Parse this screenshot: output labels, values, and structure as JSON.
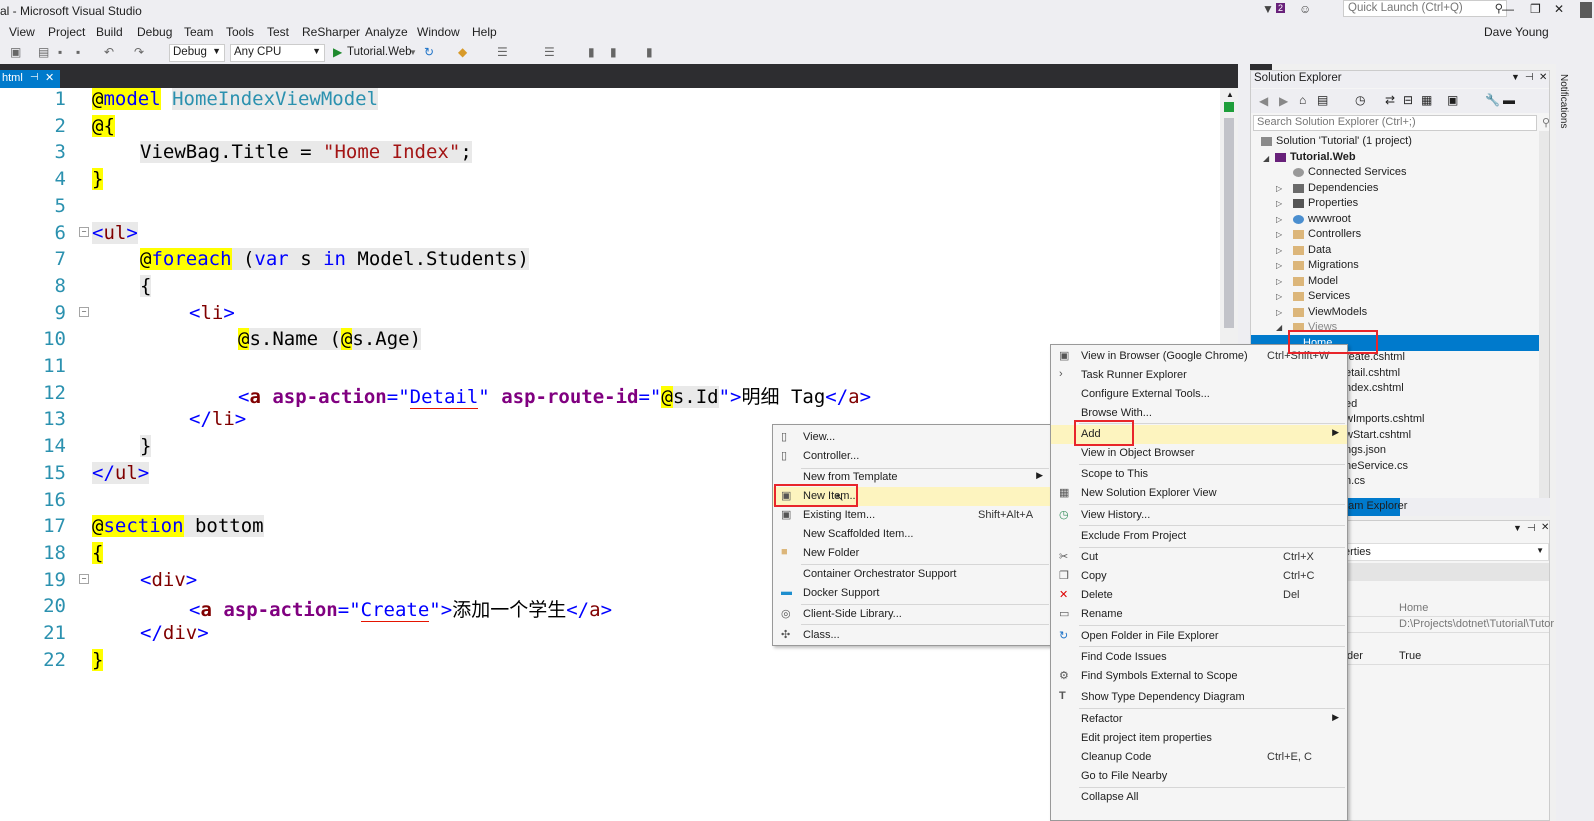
{
  "window": {
    "title": "al - Microsoft Visual Studio",
    "quick_launch_placeholder": "Quick Launch (Ctrl+Q)",
    "notification_count": "2",
    "user": "Dave Young"
  },
  "menubar": [
    "View",
    "Project",
    "Build",
    "Debug",
    "Team",
    "Tools",
    "Test",
    "ReSharper",
    "Analyze",
    "Window",
    "Help"
  ],
  "toolbar": {
    "config": "Debug",
    "platform": "Any CPU",
    "start_target": "Tutorial.Web"
  },
  "editor": {
    "tab_label": "html",
    "line_numbers": [
      "1",
      "2",
      "3",
      "4",
      "5",
      "6",
      "7",
      "8",
      "9",
      "10",
      "11",
      "12",
      "13",
      "14",
      "15",
      "16",
      "17",
      "18",
      "19",
      "20",
      "21",
      "22"
    ],
    "l1": {
      "at": "@",
      "kw": "model",
      "type": "HomeIndexViewModel"
    },
    "l2": "@{",
    "l3": {
      "a": "ViewBag.Title = ",
      "b": "\"Home Index\"",
      "c": ";"
    },
    "l4": "}",
    "l6": {
      "open": "<",
      "tag": "ul",
      "close": ">"
    },
    "l7": {
      "at": "@",
      "kw": "foreach",
      "a": " (",
      "var": "var",
      "b": " s ",
      "in": "in",
      "c": " Model.Students)"
    },
    "l8": "{",
    "l9": {
      "open": "<",
      "tag": "li",
      "close": ">"
    },
    "l10": {
      "at1": "@",
      "a": "s.Name (",
      "at2": "@",
      "b": "s.Age)"
    },
    "l12": {
      "open": "<",
      "tag": "a",
      "attr1": " asp-action",
      "eq1": "=",
      "q1": "\"",
      "v1": "Detail",
      "q2": "\"",
      "attr2": " asp-route-id",
      "eq2": "=",
      "q3": "\"",
      "at": "@",
      "v2": "s.Id",
      "q4": "\"",
      "gt": ">",
      "text": "明细 Tag",
      "end": "</",
      "etag": "a",
      "egt": ">"
    },
    "l13": {
      "open": "</",
      "tag": "li",
      "close": ">"
    },
    "l14": "}",
    "l15": {
      "open": "</",
      "tag": "ul",
      "close": ">"
    },
    "l17": {
      "at": "@",
      "kw": "section",
      "rest": " bottom"
    },
    "l18": "{",
    "l19": {
      "open": "<",
      "tag": "div",
      "close": ">"
    },
    "l20": {
      "open": "<",
      "tag": "a",
      "attr": " asp-action",
      "eq": "=",
      "q1": "\"",
      "v": "Create",
      "q2": "\"",
      "gt": ">",
      "text": "添加一个学生",
      "end": "</",
      "etag": "a",
      "egt": ">"
    },
    "l21": {
      "open": "</",
      "tag": "div",
      "close": ">"
    },
    "l22": "}"
  },
  "solution_explorer": {
    "title": "Solution Explorer",
    "search_placeholder": "Search Solution Explorer (Ctrl+;)",
    "solution": "Solution 'Tutorial' (1 project)",
    "project": "Tutorial.Web",
    "items": [
      "Connected Services",
      "Dependencies",
      "Properties",
      "wwwroot",
      "Controllers",
      "Data",
      "Migrations",
      "Model",
      "Services",
      "ViewModels",
      "Views"
    ],
    "home": "Home",
    "partial_items": [
      "reate.cshtml",
      "etail.cshtml",
      "ndex.cshtml",
      "ed",
      "wImports.cshtml",
      "wStart.cshtml",
      "ngs.json",
      "neService.cs",
      "n.cs"
    ],
    "bottom_tab": "eam Explorer"
  },
  "properties": {
    "header": "erties",
    "rows": [
      {
        "name": "",
        "value": "Home"
      },
      {
        "name": "",
        "value": "D:\\Projects\\dotnet\\Tutorial\\Tutor"
      },
      {
        "name": "der",
        "value": "True"
      }
    ]
  },
  "notifications_label": "Notifications",
  "context_menu": [
    {
      "label": "View in Browser (Google Chrome)",
      "shortcut": "Ctrl+Shift+W"
    },
    {
      "label": "Task Runner Explorer",
      "shortcut": ""
    },
    {
      "label": "Configure External Tools...",
      "shortcut": ""
    },
    {
      "label": "Browse With...",
      "shortcut": ""
    },
    {
      "label": "Add",
      "shortcut": ""
    },
    {
      "label": "View in Object Browser",
      "shortcut": ""
    },
    {
      "label": "Scope to This",
      "shortcut": ""
    },
    {
      "label": "New Solution Explorer View",
      "shortcut": ""
    },
    {
      "label": "View History...",
      "shortcut": ""
    },
    {
      "label": "Exclude From Project",
      "shortcut": ""
    },
    {
      "label": "Cut",
      "shortcut": "Ctrl+X"
    },
    {
      "label": "Copy",
      "shortcut": "Ctrl+C"
    },
    {
      "label": "Delete",
      "shortcut": "Del"
    },
    {
      "label": "Rename",
      "shortcut": ""
    },
    {
      "label": "Open Folder in File Explorer",
      "shortcut": ""
    },
    {
      "label": "Find Code Issues",
      "shortcut": ""
    },
    {
      "label": "Find Symbols External to Scope",
      "shortcut": ""
    },
    {
      "label": "Show Type Dependency Diagram",
      "shortcut": ""
    },
    {
      "label": "Refactor",
      "shortcut": ""
    },
    {
      "label": "Edit project item properties",
      "shortcut": ""
    },
    {
      "label": "Cleanup Code",
      "shortcut": "Ctrl+E, C"
    },
    {
      "label": "Go to File Nearby",
      "shortcut": ""
    },
    {
      "label": "Collapse All",
      "shortcut": ""
    }
  ],
  "add_submenu": [
    {
      "label": "View...",
      "shortcut": ""
    },
    {
      "label": "Controller...",
      "shortcut": ""
    },
    {
      "label": "New from Template",
      "shortcut": ""
    },
    {
      "label": "New Item...",
      "shortcut": ""
    },
    {
      "label": "Existing Item...",
      "shortcut": "Shift+Alt+A"
    },
    {
      "label": "New Scaffolded Item...",
      "shortcut": ""
    },
    {
      "label": "New Folder",
      "shortcut": ""
    },
    {
      "label": "Container Orchestrator Support",
      "shortcut": ""
    },
    {
      "label": "Docker Support",
      "shortcut": ""
    },
    {
      "label": "Client-Side Library...",
      "shortcut": ""
    },
    {
      "label": "Class...",
      "shortcut": ""
    }
  ],
  "colors": {
    "accent": "#007acc",
    "highlight": "#e8252b",
    "menu_hover": "#fdf4bf",
    "line_number": "#2b91af"
  }
}
